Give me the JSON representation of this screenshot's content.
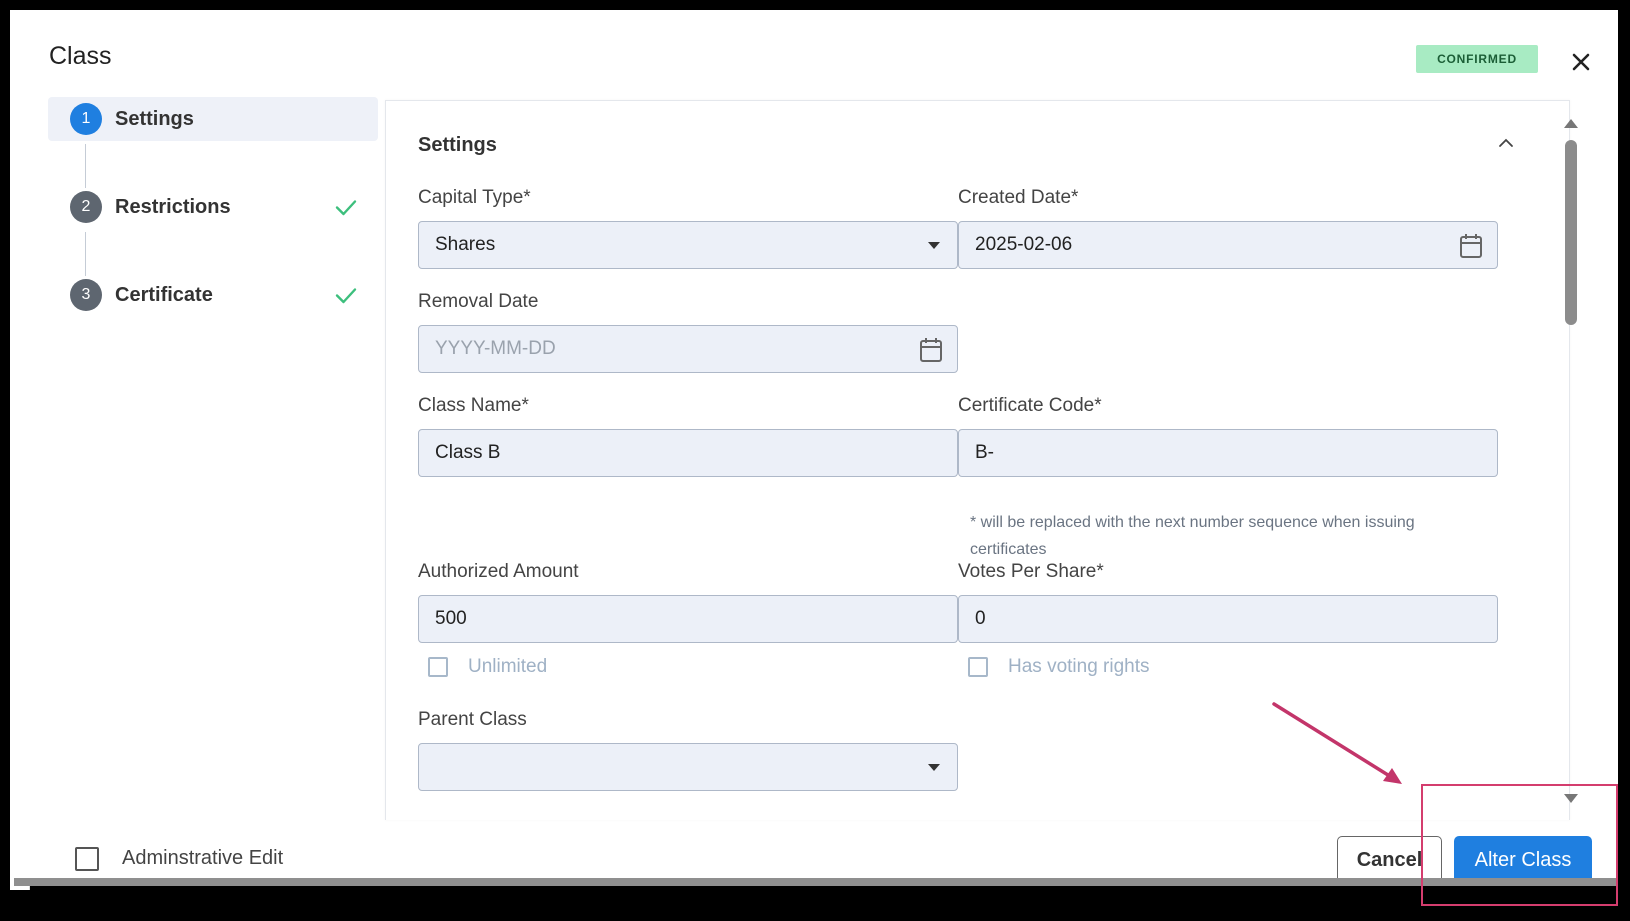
{
  "dialog": {
    "title": "Class",
    "status_badge": "CONFIRMED"
  },
  "stepper": {
    "steps": [
      {
        "num": "1",
        "label": "Settings",
        "active": true,
        "complete": false
      },
      {
        "num": "2",
        "label": "Restrictions",
        "active": false,
        "complete": true
      },
      {
        "num": "3",
        "label": "Certificate",
        "active": false,
        "complete": true
      }
    ]
  },
  "settings": {
    "section_title": "Settings",
    "capital_type": {
      "label": "Capital Type",
      "required": "*",
      "value": "Shares"
    },
    "created_date": {
      "label": "Created Date",
      "required": "*",
      "value": "2025-02-06"
    },
    "removal_date": {
      "label": "Removal Date",
      "placeholder": "YYYY-MM-DD",
      "value": ""
    },
    "class_name": {
      "label": "Class Name",
      "required": "*",
      "value": "Class B"
    },
    "certificate_code": {
      "label": "Certificate Code",
      "required": "*",
      "value": "B-",
      "hint": "* will be replaced with the next number sequence when issuing certificates"
    },
    "authorized_amount": {
      "label": "Authorized Amount",
      "value": "500",
      "checkbox_label": "Unlimited",
      "checked": false
    },
    "votes_per_share": {
      "label": "Votes Per Share",
      "required": "*",
      "value": "0",
      "checkbox_label": "Has voting rights",
      "checked": false
    },
    "parent_class": {
      "label": "Parent Class",
      "value": ""
    }
  },
  "footer": {
    "admin_edit_label": "Adminstrative Edit",
    "admin_edit_checked": false,
    "cancel_label": "Cancel",
    "alter_label": "Alter Class"
  },
  "colors": {
    "primary": "#1f7fe0",
    "badge_bg": "#a8ebc3",
    "check": "#3dbf7d",
    "annotation": "#d43d6e"
  },
  "icons": [
    "close-icon",
    "check-icon",
    "chevron-up-icon",
    "dropdown-caret-icon",
    "calendar-icon",
    "scroll-up-arrow-icon",
    "scroll-down-arrow-icon"
  ]
}
